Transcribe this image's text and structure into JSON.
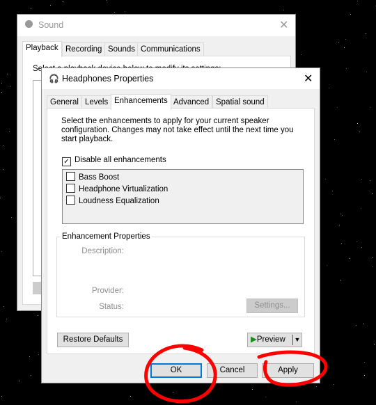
{
  "sound_window": {
    "title": "Sound",
    "tabs": [
      "Playback",
      "Recording",
      "Sounds",
      "Communications"
    ],
    "instruction": "Select a playback device below to modify its settings:"
  },
  "dialog": {
    "title": "Headphones Properties",
    "tabs": [
      "General",
      "Levels",
      "Enhancements",
      "Advanced",
      "Spatial sound"
    ],
    "active_tab": "Enhancements",
    "description": "Select the enhancements to apply for your current speaker configuration. Changes may not take effect until the next time you start playback.",
    "disable_all": {
      "label": "Disable all enhancements",
      "checked": true
    },
    "enhancements": [
      {
        "label": "Bass Boost",
        "checked": false
      },
      {
        "label": "Headphone Virtualization",
        "checked": false
      },
      {
        "label": "Loudness Equalization",
        "checked": false
      }
    ],
    "props": {
      "title": "Enhancement Properties",
      "description_label": "Description:",
      "provider_label": "Provider:",
      "status_label": "Status:",
      "settings_button": "Settings..."
    },
    "restore_defaults": "Restore Defaults",
    "preview": "Preview",
    "ok": "OK",
    "cancel": "Cancel",
    "apply": "Apply"
  },
  "annotation_color": "#ff0000"
}
